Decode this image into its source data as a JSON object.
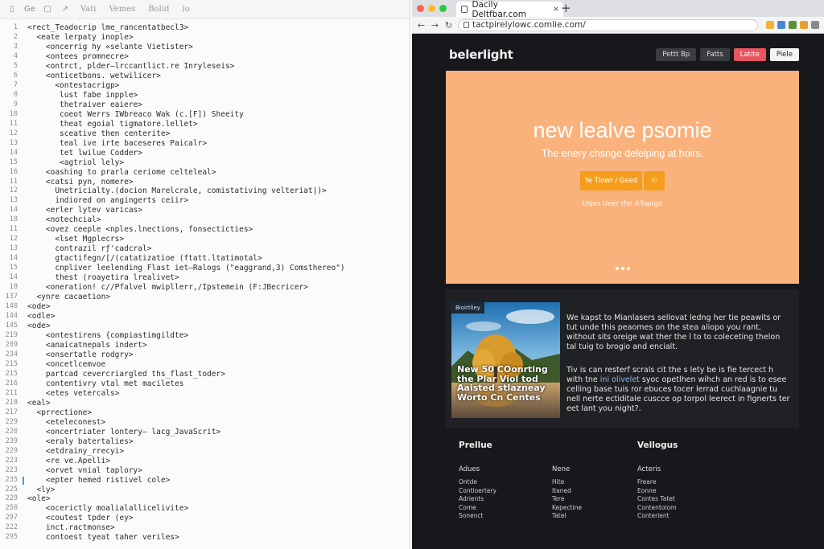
{
  "editor": {
    "toolbar": {
      "icons": [
        "file-icon",
        "copy-icon",
        "undo-icon",
        "brush-icon"
      ],
      "icon_glyphs": [
        "▯",
        "Ge",
        "▢",
        "↗"
      ],
      "menu": [
        "Vati",
        "Vemes",
        "Bolid",
        "lo"
      ]
    },
    "lines": [
      {
        "n": "1",
        "text": "<rect_Teadocrip lme_rancentatbecl3>"
      },
      {
        "n": "2",
        "text": "  <eate lerpaty inople>"
      },
      {
        "n": "3",
        "text": "    <oncerrig hy «selante Vietister>"
      },
      {
        "n": "4",
        "text": "    <ontees promnecre>"
      },
      {
        "n": "5",
        "text": "    <ontrct, plder—lrccantlict.re Inryleseis>"
      },
      {
        "n": "6",
        "text": "    <onticetbons. wetwilicer>"
      },
      {
        "n": "7",
        "text": "      <ontestacrigp>"
      },
      {
        "n": "8",
        "text": "       lust fabe inpple>"
      },
      {
        "n": "9",
        "text": "       thetraiver eaiere>"
      },
      {
        "n": "10",
        "text": "       coeot Werrs IWbreaco Wak (c.[F]) Sheeity"
      },
      {
        "n": "11",
        "text": "       theat egoial tigmatore.lellet>"
      },
      {
        "n": "12",
        "text": "       sceative then centerite>"
      },
      {
        "n": "13",
        "text": "       teal ive irte baceseres Paicalr>"
      },
      {
        "n": "14",
        "text": "       tet lwilue Codder>"
      },
      {
        "n": "15",
        "text": "       <agtriol lely>"
      },
      {
        "n": "16",
        "text": "    <oashing to prarla ceriome celteleal>"
      },
      {
        "n": "11",
        "text": "    <catsi pyn, nomere>"
      },
      {
        "n": "12",
        "text": "      Unetricialty.(docion Marelcrale, comistativing velteriat|)>"
      },
      {
        "n": "13",
        "text": "      indiored on angingerts ceiir>"
      },
      {
        "n": "14",
        "text": "    <erler lytev varicas>"
      },
      {
        "n": "18",
        "text": "    <notechcial>"
      },
      {
        "n": "11",
        "text": "    <ovez ceeple <nples.lnections, fonsecticties>"
      },
      {
        "n": "12",
        "text": "      <lset Mgplecrs>"
      },
      {
        "n": "13",
        "text": "      contrazil rƒ'cadcral>"
      },
      {
        "n": "14",
        "text": "      gtactifegn/[/(catatizatioe (ftatt.ltatimotal>"
      },
      {
        "n": "15",
        "text": "      cnpliver leelending Flast iet–Ralogs (\"eaggrand,3) Comsthereo\")"
      },
      {
        "n": "14",
        "text": "      thest (roayetira lrealivet>"
      },
      {
        "n": "18",
        "text": "    <oneration! c//Pfalvel mwipllerr,/Ipstemein (F:JBecricer>"
      },
      {
        "n": "137",
        "text": "  <ynre cacaetion>"
      },
      {
        "n": "140",
        "text": "<ode>"
      },
      {
        "n": "144",
        "text": "<odle>"
      },
      {
        "n": "145",
        "text": "<ode>"
      },
      {
        "n": "219",
        "text": "    <ontestirens {compiastimgildte>"
      },
      {
        "n": "209",
        "text": "    <anaicatnepals indert>"
      },
      {
        "n": "234",
        "text": "    <onsertatle rodgry>"
      },
      {
        "n": "215",
        "text": "    <oncetlcemvoe"
      },
      {
        "n": "215",
        "text": "    partcad cevercriargled ths_flast_toder>"
      },
      {
        "n": "216",
        "text": "    contentivry vtal met maciletes"
      },
      {
        "n": "211",
        "text": "    <etes vetercals>"
      },
      {
        "n": "218",
        "text": "<eal>"
      },
      {
        "n": "217",
        "text": "  <prrectione>"
      },
      {
        "n": "229",
        "text": "    <eteleconest>"
      },
      {
        "n": "220",
        "text": "    <oncertriater lontery– lacg_JavaScrit>"
      },
      {
        "n": "239",
        "text": "    <eraly batertalies>"
      },
      {
        "n": "229",
        "text": "    <etdrainy_rrecyi>"
      },
      {
        "n": "223",
        "text": "    <re ve.Apelli>"
      },
      {
        "n": "223",
        "text": "    <orvet vnial taplory>"
      },
      {
        "n": "235",
        "text": "    <epter hemed ristivel cole>"
      },
      {
        "n": "225",
        "text": "  <ly>"
      },
      {
        "n": "229",
        "text": "<ole>"
      },
      {
        "n": "250",
        "text": "    <ocerictly moalialallicelivite>"
      },
      {
        "n": "297",
        "text": "    <coutest tpder (ey>"
      },
      {
        "n": "222",
        "text": "    inct.ractmonse>"
      },
      {
        "n": "295",
        "text": "    contoest tyeat taher veriles>"
      }
    ],
    "marked_line": 47
  },
  "browser": {
    "tab_title": "Dacily Deltfbar.com",
    "tab_close": "×",
    "new_tab": "+",
    "nav": {
      "back": "←",
      "forward": "→",
      "reload": "↻"
    },
    "url": "tactpirelylowc.comlie.com/",
    "colors": {
      "close": "#ff5f57",
      "minimize": "#febc2e",
      "maximize": "#28c840",
      "brand_red": "#e65560",
      "hero_bg": "#fab27c",
      "hero_button": "#f59e1c"
    }
  },
  "site": {
    "logo": "belerlight",
    "nav_buttons": [
      "Pettt Bp",
      "Fatts",
      "Latite",
      "Piele"
    ],
    "hero": {
      "title": "new lealve psomie",
      "subtitle": "The enery chsnge delelping at hoirs.",
      "primary_button": "Ye Tiowr / Geed",
      "round_button": "☉",
      "link": "Usjes Ueer the A'hange"
    },
    "feature": {
      "tag": "Bioirtliey",
      "image_caption": "New 50 COonrting the Plar Viol tod Aaisted stlazneay Worto Cn Centes",
      "paragraph1": "We kapst to Mianlasers sellovat ledng her tie peawits or tut unde this peaomes on the stea aliopo you rant, without sits oreige wat ther the l to to coleceting thelon tal tuig to brogio and encialt.",
      "paragraph2_start": "Tiv is can resterf scrals cit the s lety be is fie tercect h with tne ",
      "paragraph2_link": "ini olivelet",
      "paragraph2_end": " syoc opetlhen wihch an red is to esee celling base tuis ror ebuces tocer lerrad cuchlaagnie tu nell nerte ectiditale cuscce op torpol leerect in fignerts ter eet lant you night?."
    },
    "footer": {
      "col1": {
        "heading": "Prellue",
        "sub": "Adues",
        "links": [
          "Ontde",
          "Contloertery",
          "Adrients",
          "Come",
          "Sonenct"
        ]
      },
      "col2": {
        "heading": "",
        "sub": "Nene",
        "links": [
          "Hite",
          "Itaned",
          "Tere",
          "Kepectine",
          "Tatel"
        ]
      },
      "col3": {
        "heading": "Vellogus",
        "sub": "Acteris",
        "links": [
          "Freare",
          "Eonne",
          "Contes Tatet",
          "Contentolom",
          "Conterient"
        ]
      }
    }
  }
}
